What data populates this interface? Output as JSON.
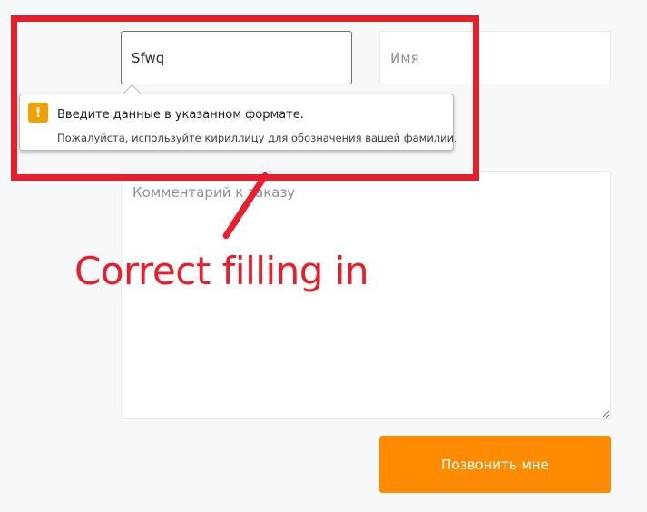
{
  "form": {
    "surname_value": "Sfwq",
    "name_placeholder": "Имя",
    "comment_placeholder": "Комментарий к заказу",
    "submit_label": "Позвонить мне"
  },
  "validation_tooltip": {
    "icon": "warning-icon",
    "icon_glyph": "!",
    "icon_color": "#f2a100",
    "title": "Введите данные в указанном формате.",
    "message": "Пожалуйста, используйте кириллицу для обозначения вашей фамилии."
  },
  "annotation": {
    "text": "Correct filling in",
    "color": "#e81e2b"
  },
  "colors": {
    "accent": "#ff8c00",
    "page_background": "#f7f8fa"
  }
}
